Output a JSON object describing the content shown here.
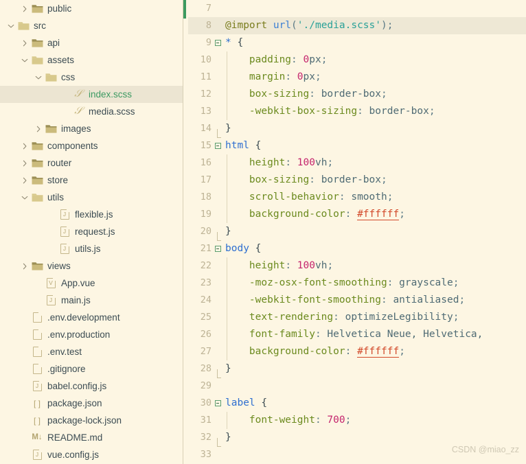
{
  "explorer": {
    "items": [
      {
        "label": "public",
        "indent": 1,
        "type": "folder",
        "state": "collapsed",
        "selected": false
      },
      {
        "label": "src",
        "indent": 0,
        "type": "folder",
        "state": "expanded",
        "selected": false
      },
      {
        "label": "api",
        "indent": 1,
        "type": "folder",
        "state": "collapsed",
        "selected": false
      },
      {
        "label": "assets",
        "indent": 1,
        "type": "folder",
        "state": "expanded",
        "selected": false
      },
      {
        "label": "css",
        "indent": 2,
        "type": "folder",
        "state": "expanded",
        "selected": false
      },
      {
        "label": "index.scss",
        "indent": 4,
        "type": "scss",
        "state": "none",
        "selected": true
      },
      {
        "label": "media.scss",
        "indent": 4,
        "type": "scss",
        "state": "none",
        "selected": false
      },
      {
        "label": "images",
        "indent": 2,
        "type": "folder",
        "state": "collapsed",
        "selected": false
      },
      {
        "label": "components",
        "indent": 1,
        "type": "folder",
        "state": "collapsed",
        "selected": false
      },
      {
        "label": "router",
        "indent": 1,
        "type": "folder",
        "state": "collapsed",
        "selected": false
      },
      {
        "label": "store",
        "indent": 1,
        "type": "folder",
        "state": "collapsed",
        "selected": false
      },
      {
        "label": "utils",
        "indent": 1,
        "type": "folder",
        "state": "expanded",
        "selected": false
      },
      {
        "label": "flexible.js",
        "indent": 3,
        "type": "js",
        "state": "none",
        "selected": false
      },
      {
        "label": "request.js",
        "indent": 3,
        "type": "js",
        "state": "none",
        "selected": false
      },
      {
        "label": "utils.js",
        "indent": 3,
        "type": "js",
        "state": "none",
        "selected": false
      },
      {
        "label": "views",
        "indent": 1,
        "type": "folder",
        "state": "collapsed",
        "selected": false
      },
      {
        "label": "App.vue",
        "indent": 2,
        "type": "vue",
        "state": "none",
        "selected": false
      },
      {
        "label": "main.js",
        "indent": 2,
        "type": "js",
        "state": "none",
        "selected": false
      },
      {
        "label": ".env.development",
        "indent": 1,
        "type": "plain",
        "state": "none",
        "selected": false
      },
      {
        "label": ".env.production",
        "indent": 1,
        "type": "plain",
        "state": "none",
        "selected": false
      },
      {
        "label": ".env.test",
        "indent": 1,
        "type": "plain",
        "state": "none",
        "selected": false
      },
      {
        "label": ".gitignore",
        "indent": 1,
        "type": "plain",
        "state": "none",
        "selected": false
      },
      {
        "label": "babel.config.js",
        "indent": 1,
        "type": "js",
        "state": "none",
        "selected": false
      },
      {
        "label": "package.json",
        "indent": 1,
        "type": "json",
        "state": "none",
        "selected": false
      },
      {
        "label": "package-lock.json",
        "indent": 1,
        "type": "json",
        "state": "none",
        "selected": false
      },
      {
        "label": "README.md",
        "indent": 1,
        "type": "md",
        "state": "none",
        "selected": false
      },
      {
        "label": "vue.config.js",
        "indent": 1,
        "type": "js",
        "state": "none",
        "selected": false
      }
    ]
  },
  "editor": {
    "current_line": 8,
    "lines": [
      {
        "n": 7,
        "fold": "none",
        "guide": 0,
        "tokens": []
      },
      {
        "n": 8,
        "fold": "none",
        "guide": 0,
        "tokens": [
          {
            "t": "@import",
            "c": "t-at"
          },
          {
            "t": " ",
            "c": "t-punc"
          },
          {
            "t": "url",
            "c": "t-fn"
          },
          {
            "t": "(",
            "c": "t-punc"
          },
          {
            "t": "'./media.scss'",
            "c": "t-str"
          },
          {
            "t": ")",
            "c": "t-punc"
          },
          {
            "t": ";",
            "c": "t-punc"
          }
        ]
      },
      {
        "n": 9,
        "fold": "open",
        "guide": 0,
        "tokens": [
          {
            "t": "*",
            "c": "t-star"
          },
          {
            "t": " {",
            "c": "t-brace"
          }
        ]
      },
      {
        "n": 10,
        "fold": "mid",
        "guide": 1,
        "tokens": [
          {
            "t": "    padding",
            "c": "t-prop"
          },
          {
            "t": ": ",
            "c": "t-punc"
          },
          {
            "t": "0",
            "c": "t-num"
          },
          {
            "t": "px",
            "c": "t-val"
          },
          {
            "t": ";",
            "c": "t-punc"
          }
        ]
      },
      {
        "n": 11,
        "fold": "mid",
        "guide": 1,
        "tokens": [
          {
            "t": "    margin",
            "c": "t-prop"
          },
          {
            "t": ": ",
            "c": "t-punc"
          },
          {
            "t": "0",
            "c": "t-num"
          },
          {
            "t": "px",
            "c": "t-val"
          },
          {
            "t": ";",
            "c": "t-punc"
          }
        ]
      },
      {
        "n": 12,
        "fold": "mid",
        "guide": 1,
        "tokens": [
          {
            "t": "    box-sizing",
            "c": "t-prop"
          },
          {
            "t": ": ",
            "c": "t-punc"
          },
          {
            "t": "border-box",
            "c": "t-val"
          },
          {
            "t": ";",
            "c": "t-punc"
          }
        ]
      },
      {
        "n": 13,
        "fold": "mid",
        "guide": 1,
        "tokens": [
          {
            "t": "    -webkit-box-sizing",
            "c": "t-prop"
          },
          {
            "t": ": ",
            "c": "t-punc"
          },
          {
            "t": "border-box",
            "c": "t-val"
          },
          {
            "t": ";",
            "c": "t-punc"
          }
        ]
      },
      {
        "n": 14,
        "fold": "end",
        "guide": 0,
        "tokens": [
          {
            "t": "}",
            "c": "t-brace"
          }
        ]
      },
      {
        "n": 15,
        "fold": "open",
        "guide": 0,
        "tokens": [
          {
            "t": "html",
            "c": "t-sel"
          },
          {
            "t": " {",
            "c": "t-brace"
          }
        ]
      },
      {
        "n": 16,
        "fold": "mid",
        "guide": 1,
        "tokens": [
          {
            "t": "    height",
            "c": "t-prop"
          },
          {
            "t": ": ",
            "c": "t-punc"
          },
          {
            "t": "100",
            "c": "t-num"
          },
          {
            "t": "vh",
            "c": "t-val"
          },
          {
            "t": ";",
            "c": "t-punc"
          }
        ]
      },
      {
        "n": 17,
        "fold": "mid",
        "guide": 1,
        "tokens": [
          {
            "t": "    box-sizing",
            "c": "t-prop"
          },
          {
            "t": ": ",
            "c": "t-punc"
          },
          {
            "t": "border-box",
            "c": "t-val"
          },
          {
            "t": ";",
            "c": "t-punc"
          }
        ]
      },
      {
        "n": 18,
        "fold": "mid",
        "guide": 1,
        "tokens": [
          {
            "t": "    scroll-behavior",
            "c": "t-prop"
          },
          {
            "t": ": ",
            "c": "t-punc"
          },
          {
            "t": "smooth",
            "c": "t-val"
          },
          {
            "t": ";",
            "c": "t-punc"
          }
        ]
      },
      {
        "n": 19,
        "fold": "mid",
        "guide": 1,
        "tokens": [
          {
            "t": "    background-color",
            "c": "t-prop"
          },
          {
            "t": ": ",
            "c": "t-punc"
          },
          {
            "t": "#ffffff",
            "c": "t-hex"
          },
          {
            "t": ";",
            "c": "t-punc"
          }
        ]
      },
      {
        "n": 20,
        "fold": "end",
        "guide": 0,
        "tokens": [
          {
            "t": "}",
            "c": "t-brace"
          }
        ]
      },
      {
        "n": 21,
        "fold": "open",
        "guide": 0,
        "tokens": [
          {
            "t": "body",
            "c": "t-sel"
          },
          {
            "t": " {",
            "c": "t-brace"
          }
        ]
      },
      {
        "n": 22,
        "fold": "mid",
        "guide": 1,
        "tokens": [
          {
            "t": "    height",
            "c": "t-prop"
          },
          {
            "t": ": ",
            "c": "t-punc"
          },
          {
            "t": "100",
            "c": "t-num"
          },
          {
            "t": "vh",
            "c": "t-val"
          },
          {
            "t": ";",
            "c": "t-punc"
          }
        ]
      },
      {
        "n": 23,
        "fold": "mid",
        "guide": 1,
        "tokens": [
          {
            "t": "    -moz-osx-font-smoothing",
            "c": "t-prop"
          },
          {
            "t": ": ",
            "c": "t-punc"
          },
          {
            "t": "grayscale",
            "c": "t-val"
          },
          {
            "t": ";",
            "c": "t-punc"
          }
        ]
      },
      {
        "n": 24,
        "fold": "mid",
        "guide": 1,
        "tokens": [
          {
            "t": "    -webkit-font-smoothing",
            "c": "t-prop"
          },
          {
            "t": ": ",
            "c": "t-punc"
          },
          {
            "t": "antialiased",
            "c": "t-val"
          },
          {
            "t": ";",
            "c": "t-punc"
          }
        ]
      },
      {
        "n": 25,
        "fold": "mid",
        "guide": 1,
        "tokens": [
          {
            "t": "    text-rendering",
            "c": "t-prop"
          },
          {
            "t": ": ",
            "c": "t-punc"
          },
          {
            "t": "optimizeLegibility",
            "c": "t-val"
          },
          {
            "t": ";",
            "c": "t-punc"
          }
        ]
      },
      {
        "n": 26,
        "fold": "mid",
        "guide": 1,
        "tokens": [
          {
            "t": "    font-family",
            "c": "t-prop"
          },
          {
            "t": ": ",
            "c": "t-punc"
          },
          {
            "t": "Helvetica Neue, Helvetica,",
            "c": "t-val"
          }
        ]
      },
      {
        "n": 27,
        "fold": "mid",
        "guide": 1,
        "tokens": [
          {
            "t": "    background-color",
            "c": "t-prop"
          },
          {
            "t": ": ",
            "c": "t-punc"
          },
          {
            "t": "#ffffff",
            "c": "t-hex"
          },
          {
            "t": ";",
            "c": "t-punc"
          }
        ]
      },
      {
        "n": 28,
        "fold": "end",
        "guide": 0,
        "tokens": [
          {
            "t": "}",
            "c": "t-brace"
          }
        ]
      },
      {
        "n": 29,
        "fold": "none",
        "guide": 0,
        "tokens": []
      },
      {
        "n": 30,
        "fold": "open",
        "guide": 0,
        "tokens": [
          {
            "t": "label",
            "c": "t-sel"
          },
          {
            "t": " {",
            "c": "t-brace"
          }
        ]
      },
      {
        "n": 31,
        "fold": "mid",
        "guide": 1,
        "tokens": [
          {
            "t": "    font-weight",
            "c": "t-prop"
          },
          {
            "t": ": ",
            "c": "t-punc"
          },
          {
            "t": "700",
            "c": "t-num"
          },
          {
            "t": ";",
            "c": "t-punc"
          }
        ]
      },
      {
        "n": 32,
        "fold": "end",
        "guide": 0,
        "tokens": [
          {
            "t": "}",
            "c": "t-brace"
          }
        ]
      },
      {
        "n": 33,
        "fold": "none",
        "guide": 0,
        "tokens": []
      }
    ]
  },
  "watermark": {
    "text": "CSDN @miao_zz"
  },
  "colors": {
    "background": "#fdf6e3",
    "selection": "#ece5d2",
    "current_line": "#eee8d5",
    "change_marker": "#3c9a5f",
    "selected_text": "#3c9a62"
  },
  "icons": {
    "chevron_right": "chevron-right-icon",
    "chevron_down": "chevron-down-icon",
    "folder": "folder-icon",
    "scss_file": "scss-file-icon",
    "js_file": "js-file-icon",
    "vue_file": "vue-file-icon",
    "json_file": "json-file-icon",
    "md_file": "markdown-file-icon",
    "plain_file": "plain-file-icon"
  }
}
